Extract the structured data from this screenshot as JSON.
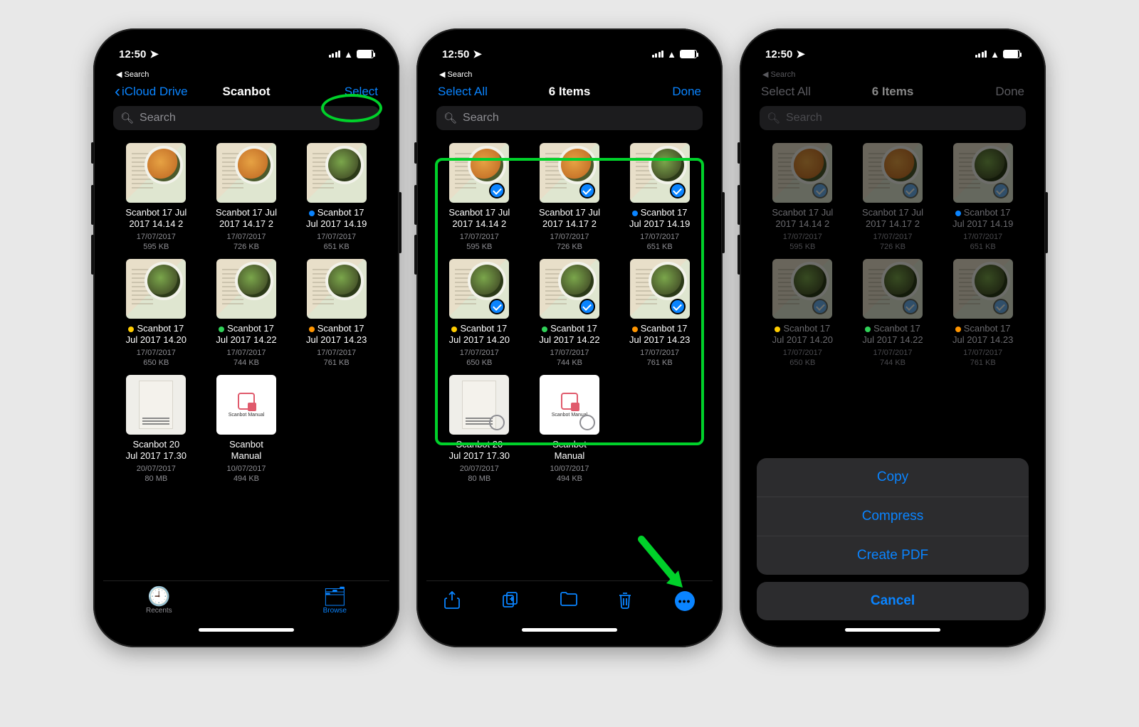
{
  "status": {
    "time": "12:50",
    "back_app": "Search"
  },
  "colors": {
    "link": "#0a84ff",
    "highlight": "#00d12a"
  },
  "screen1": {
    "nav": {
      "back": "iCloud Drive",
      "title": "Scanbot",
      "right": "Select"
    },
    "search_placeholder": "Search",
    "tabs": {
      "recents": "Recents",
      "browse": "Browse"
    }
  },
  "screen2": {
    "nav": {
      "left": "Select All",
      "title": "6 Items",
      "right": "Done"
    },
    "search_placeholder": "Search"
  },
  "screen3": {
    "nav": {
      "left": "Select All",
      "title": "6 Items",
      "right": "Done"
    },
    "search_placeholder": "Search",
    "sheet": {
      "copy": "Copy",
      "compress": "Compress",
      "create_pdf": "Create PDF",
      "cancel": "Cancel"
    }
  },
  "files": [
    {
      "name_l1": "Scanbot 17 Jul",
      "name_l2": "2017 14.14 2",
      "date": "17/07/2017",
      "size": "595 KB",
      "tag": "",
      "thumb": "v1"
    },
    {
      "name_l1": "Scanbot 17 Jul",
      "name_l2": "2017 14.17 2",
      "date": "17/07/2017",
      "size": "726 KB",
      "tag": "",
      "thumb": "v1"
    },
    {
      "name_l1": "Scanbot 17",
      "name_l2": "Jul 2017 14.19",
      "date": "17/07/2017",
      "size": "651 KB",
      "tag": "blue",
      "thumb": "v2"
    },
    {
      "name_l1": "Scanbot 17",
      "name_l2": "Jul 2017 14.20",
      "date": "17/07/2017",
      "size": "650 KB",
      "tag": "yellow",
      "thumb": "v2"
    },
    {
      "name_l1": "Scanbot 17",
      "name_l2": "Jul 2017 14.22",
      "date": "17/07/2017",
      "size": "744 KB",
      "tag": "green",
      "thumb": "v2"
    },
    {
      "name_l1": "Scanbot 17",
      "name_l2": "Jul 2017 14.23",
      "date": "17/07/2017",
      "size": "761 KB",
      "tag": "orange",
      "thumb": "v2"
    },
    {
      "name_l1": "Scanbot 20",
      "name_l2": "Jul 2017 17.30",
      "date": "20/07/2017",
      "size": "80 MB",
      "tag": "",
      "thumb": "book"
    },
    {
      "name_l1": "Scanbot",
      "name_l2": "Manual",
      "date": "10/07/2017",
      "size": "494 KB",
      "tag": "",
      "thumb": "doc"
    }
  ]
}
